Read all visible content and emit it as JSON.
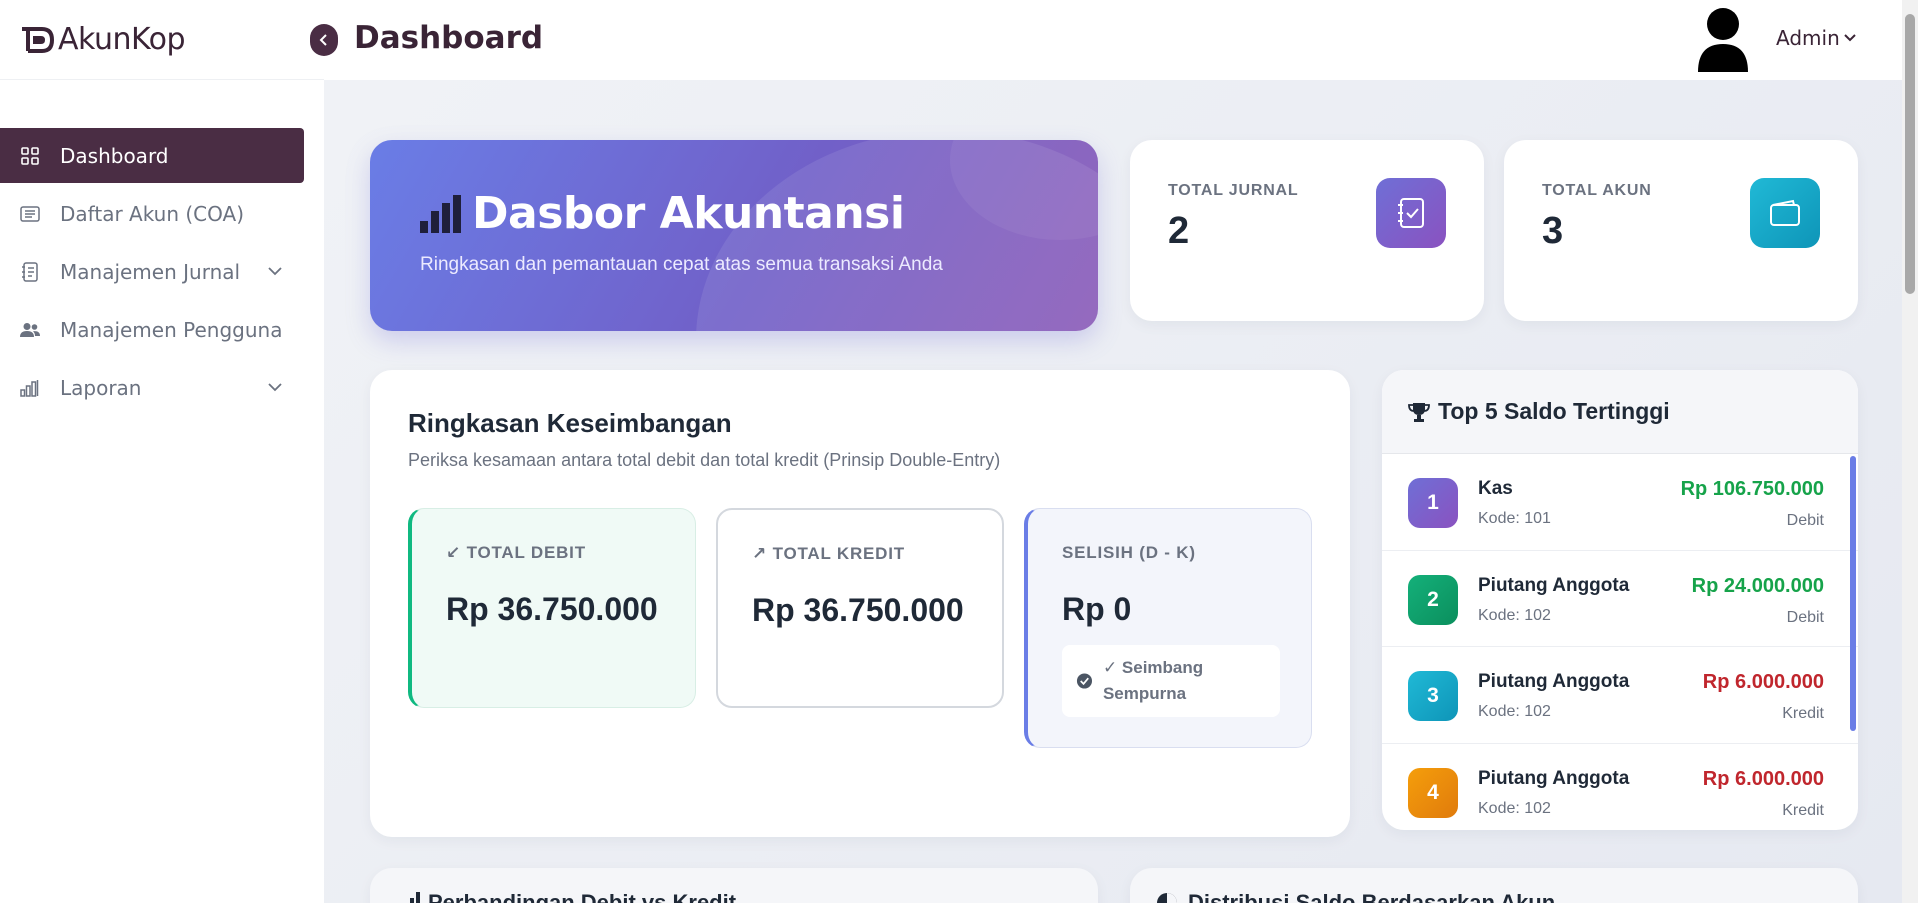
{
  "brand": {
    "name": "AkunKop"
  },
  "sidebar": {
    "items": [
      {
        "label": "Dashboard",
        "icon": "grid-icon",
        "active": true
      },
      {
        "label": "Daftar Akun (COA)",
        "icon": "list-icon"
      },
      {
        "label": "Manajemen Jurnal",
        "icon": "journal-icon",
        "has_submenu": true
      },
      {
        "label": "Manajemen Pengguna",
        "icon": "users-icon"
      },
      {
        "label": "Laporan",
        "icon": "chart-icon",
        "has_submenu": true
      }
    ]
  },
  "header": {
    "title": "Dashboard",
    "user": "Admin"
  },
  "hero": {
    "title": "Dasbor Akuntansi",
    "subtitle": "Ringkasan dan pemantauan cepat atas semua transaksi Anda"
  },
  "stats": [
    {
      "label": "TOTAL JURNAL",
      "value": "2",
      "icon": "journal-check-icon",
      "color": "#7a5cc9"
    },
    {
      "label": "TOTAL AKUN",
      "value": "3",
      "icon": "wallet-icon",
      "color": "#19a8c8"
    }
  ],
  "balance": {
    "title": "Ringkasan Keseimbangan",
    "subtitle": "Periksa kesamaan antara total debit dan total kredit (Prinsip Double-Entry)",
    "debit": {
      "label": "TOTAL DEBIT",
      "value": "Rp 36.750.000",
      "icon": "arrow-down-left-icon"
    },
    "kredit": {
      "label": "TOTAL KREDIT",
      "value": "Rp 36.750.000",
      "icon": "arrow-up-right-icon"
    },
    "selisih": {
      "label": "SELISIH (D - K)",
      "value": "Rp 0",
      "status": "✓ Seimbang Sempurna",
      "status_icon": "check-circle-icon"
    }
  },
  "top5": {
    "title": "Top 5 Saldo Tertinggi",
    "icon": "trophy-icon",
    "rows": [
      {
        "rank": "1",
        "name": "Kas",
        "code": "Kode: 101",
        "amount": "Rp 106.750.000",
        "type": "Debit",
        "rank_color": "#7a5cc9",
        "amount_color": "#16a34a"
      },
      {
        "rank": "2",
        "name": "Piutang Anggota",
        "code": "Kode: 102",
        "amount": "Rp 24.000.000",
        "type": "Debit",
        "rank_color": "#10a36a",
        "amount_color": "#16a34a"
      },
      {
        "rank": "3",
        "name": "Piutang Anggota",
        "code": "Kode: 102",
        "amount": "Rp 6.000.000",
        "type": "Kredit",
        "rank_color": "#19a8c8",
        "amount_color": "#c0262d"
      },
      {
        "rank": "4",
        "name": "Piutang Anggota",
        "code": "Kode: 102",
        "amount": "Rp 6.000.000",
        "type": "Kredit",
        "rank_color": "#ee8a10",
        "amount_color": "#c0262d"
      }
    ]
  },
  "bottom": {
    "left_title": "Perbandingan Debit vs Kredit",
    "right_title": "Distribusi Saldo Berdasarkan Akun"
  },
  "colors": {
    "primary": "#4a2d44",
    "hero_start": "#6a7de6",
    "hero_end": "#8b5cb8",
    "debit_accent": "#10b981",
    "selisih_accent": "#6a7de6"
  }
}
